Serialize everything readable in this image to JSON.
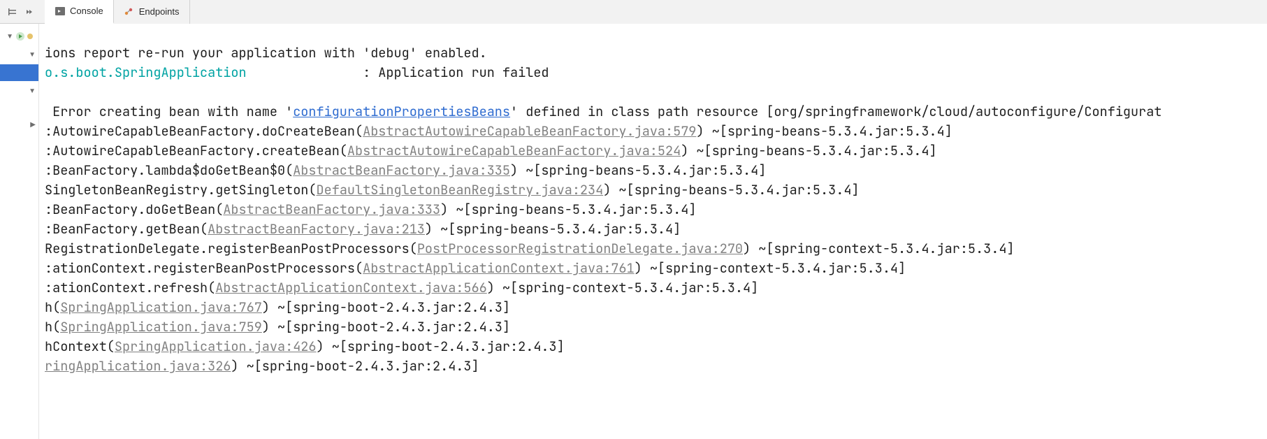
{
  "topbar": {
    "tabs": [
      {
        "label": "Console",
        "active": true
      },
      {
        "label": "Endpoints",
        "active": false
      }
    ]
  },
  "console": {
    "line1_text": "ions report re-run your application with 'debug' enabled.",
    "line2_logger": "o.s.boot.SpringApplication",
    "line2_pad": "               ",
    "line2_rest": ": Application run failed",
    "err_pre": " Error creating bean with name '",
    "err_link": "configurationPropertiesBeans",
    "err_post": "' defined in class path resource [org/springframework/cloud/autoconfigure/Configurat",
    "stack": [
      {
        "pre": ":AutowireCapableBeanFactory.doCreateBean(",
        "link": "AbstractAutowireCapableBeanFactory.java:579",
        "post": ") ~[spring-beans-5.3.4.jar:5.3.4]"
      },
      {
        "pre": ":AutowireCapableBeanFactory.createBean(",
        "link": "AbstractAutowireCapableBeanFactory.java:524",
        "post": ") ~[spring-beans-5.3.4.jar:5.3.4]"
      },
      {
        "pre": ":BeanFactory.lambda$doGetBean$0(",
        "link": "AbstractBeanFactory.java:335",
        "post": ") ~[spring-beans-5.3.4.jar:5.3.4]"
      },
      {
        "pre": "SingletonBeanRegistry.getSingleton(",
        "link": "DefaultSingletonBeanRegistry.java:234",
        "post": ") ~[spring-beans-5.3.4.jar:5.3.4]"
      },
      {
        "pre": ":BeanFactory.doGetBean(",
        "link": "AbstractBeanFactory.java:333",
        "post": ") ~[spring-beans-5.3.4.jar:5.3.4]"
      },
      {
        "pre": ":BeanFactory.getBean(",
        "link": "AbstractBeanFactory.java:213",
        "post": ") ~[spring-beans-5.3.4.jar:5.3.4]"
      },
      {
        "pre": "RegistrationDelegate.registerBeanPostProcessors(",
        "link": "PostProcessorRegistrationDelegate.java:270",
        "post": ") ~[spring-context-5.3.4.jar:5.3.4]"
      },
      {
        "pre": ":ationContext.registerBeanPostProcessors(",
        "link": "AbstractApplicationContext.java:761",
        "post": ") ~[spring-context-5.3.4.jar:5.3.4]"
      },
      {
        "pre": ":ationContext.refresh(",
        "link": "AbstractApplicationContext.java:566",
        "post": ") ~[spring-context-5.3.4.jar:5.3.4]"
      },
      {
        "pre": "h(",
        "link": "SpringApplication.java:767",
        "post": ") ~[spring-boot-2.4.3.jar:2.4.3]"
      },
      {
        "pre": "h(",
        "link": "SpringApplication.java:759",
        "post": ") ~[spring-boot-2.4.3.jar:2.4.3]"
      },
      {
        "pre": "hContext(",
        "link": "SpringApplication.java:426",
        "post": ") ~[spring-boot-2.4.3.jar:2.4.3]"
      },
      {
        "pre": "",
        "link": "ringApplication.java:326",
        "post": ") ~[spring-boot-2.4.3.jar:2.4.3]"
      }
    ]
  }
}
